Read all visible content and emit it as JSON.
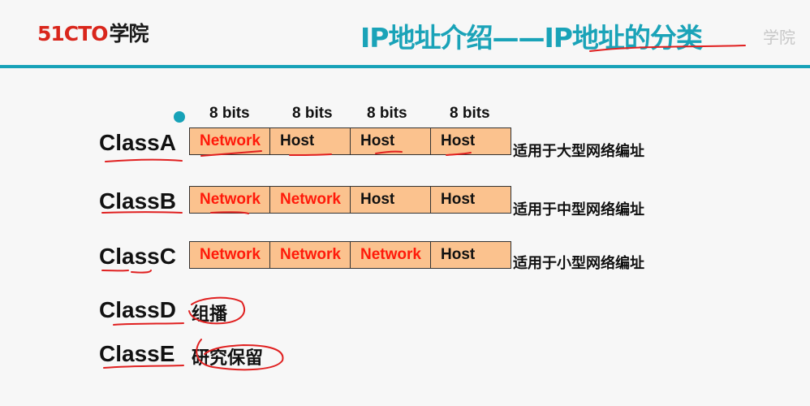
{
  "header": {
    "logo_number": "51CTO",
    "logo_text": "学院",
    "title": "IP地址介绍——IP地址的分类",
    "watermark": "学院"
  },
  "bits_labels": [
    "8 bits",
    "8 bits",
    "8 bits",
    "8 bits"
  ],
  "classes": [
    {
      "name": "ClassA",
      "fields": [
        {
          "label": "Network",
          "type": "net"
        },
        {
          "label": "Host",
          "type": "host"
        },
        {
          "label": "Host",
          "type": "host"
        },
        {
          "label": "Host",
          "type": "host"
        }
      ],
      "description": "适用于大型网络编址"
    },
    {
      "name": "ClassB",
      "fields": [
        {
          "label": "Network",
          "type": "net"
        },
        {
          "label": "Network",
          "type": "net"
        },
        {
          "label": "Host",
          "type": "host"
        },
        {
          "label": "Host",
          "type": "host"
        }
      ],
      "description": "适用于中型网络编址"
    },
    {
      "name": "ClassC",
      "fields": [
        {
          "label": "Network",
          "type": "net"
        },
        {
          "label": "Network",
          "type": "net"
        },
        {
          "label": "Network",
          "type": "net"
        },
        {
          "label": "Host",
          "type": "host"
        }
      ],
      "description": "适用于小型网络编址"
    },
    {
      "name": "ClassD",
      "note": "组播"
    },
    {
      "name": "ClassE",
      "note": "研究保留"
    }
  ],
  "colors": {
    "accent": "#17a2b8",
    "network": "#ff1a0a",
    "field_bg": "#fbc28e",
    "annotation": "#e02020"
  }
}
